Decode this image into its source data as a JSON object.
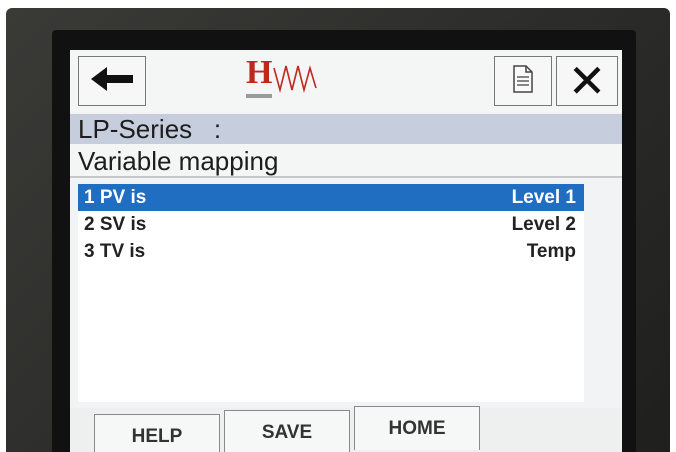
{
  "toolbar": {
    "back_icon": "arrow-left-icon",
    "logo_letter": "H",
    "doc_icon": "document-icon",
    "close_glyph": "✕"
  },
  "header": {
    "series": "LP-Series   :"
  },
  "screen": {
    "title": "Variable mapping"
  },
  "list": {
    "items": [
      {
        "label": "1 PV is",
        "value": "Level 1",
        "selected": true
      },
      {
        "label": "2 SV is",
        "value": "Level 2",
        "selected": false
      },
      {
        "label": "3 TV is",
        "value": "Temp",
        "selected": false
      }
    ]
  },
  "softkeys": {
    "help": "HELP",
    "save": "SAVE",
    "home": "HOME"
  },
  "colors": {
    "selection": "#1f6ec2",
    "header_band": "#c6cedd",
    "logo_red": "#c0281e"
  }
}
